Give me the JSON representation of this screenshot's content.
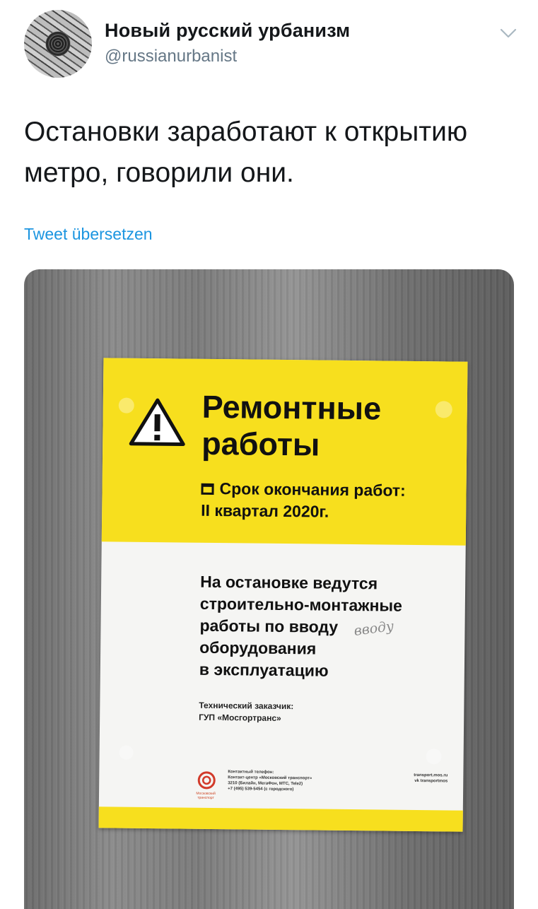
{
  "tweet": {
    "display_name": "Новый русский урбанизм",
    "handle": "@russianurbanist",
    "text": "Остановки заработают к открытию метро, говорили они.",
    "translate_label": "Tweet übersetzen"
  },
  "icons": {
    "menu": "chevron-down-icon",
    "avatar": "manhole-cover-avatar"
  },
  "colors": {
    "link": "#1b95e0",
    "secondary_text": "#657786",
    "poster_yellow": "#f7df1e"
  },
  "poster": {
    "title_line1": "Ремонтные",
    "title_line2": "работы",
    "deadline_line1": "Срок окончания работ:",
    "deadline_line2": "II квартал 2020г.",
    "notice_lines": [
      "На остановке ведутся",
      "строительно-монтажные",
      "работы по вводу",
      "оборудования",
      "в эксплуатацию"
    ],
    "handwritten_note": "вводу",
    "customer_line1": "Технический заказчик:",
    "customer_line2": "ГУП «Мосгортранс»",
    "logo_text": "Московский транспорт",
    "contact_lines": [
      "Контактный телефон:",
      "Контакт-центр «Московский транспорт»",
      "3210 (Билайн, МегаФон, МТС, Tele2)",
      "+7 (495) 539-5454 (с городского)"
    ],
    "site_lines": [
      "transport.mos.ru",
      "vk transportmos"
    ]
  }
}
